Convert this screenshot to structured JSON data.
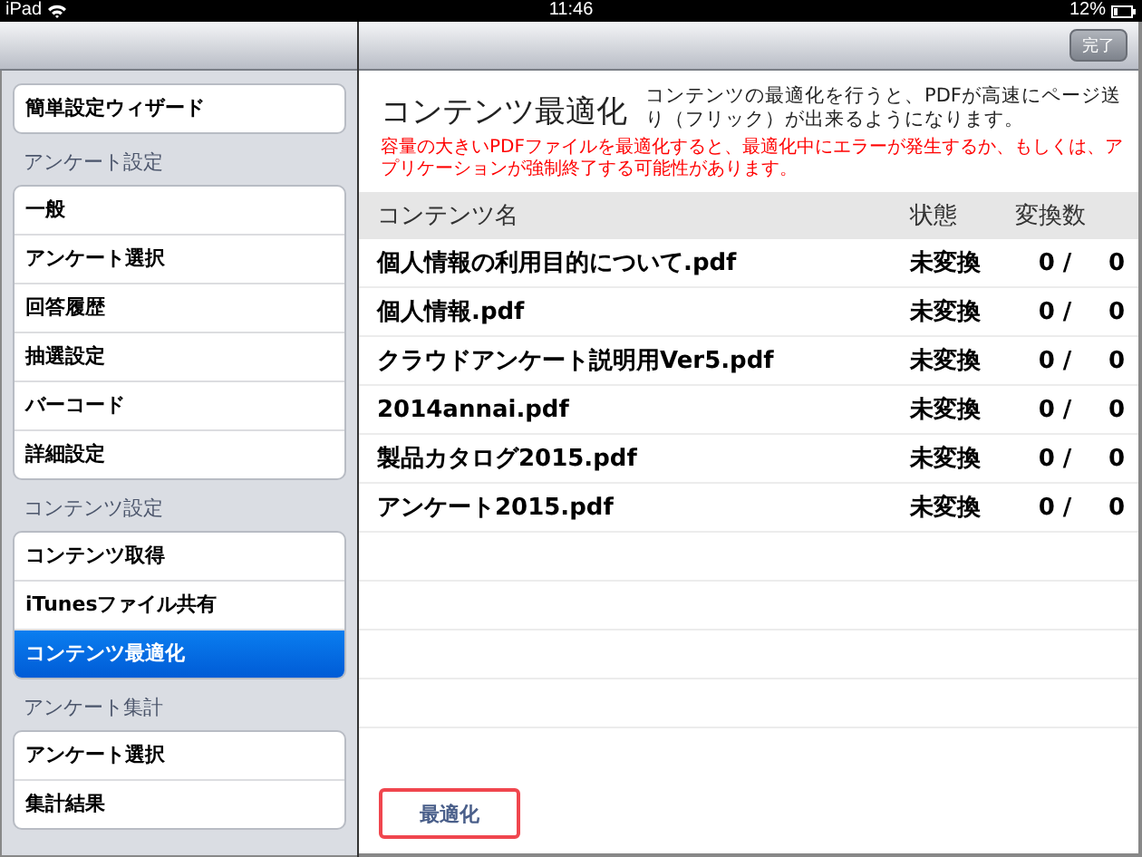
{
  "status_bar": {
    "device": "iPad",
    "time": "11:46",
    "battery": "12%"
  },
  "nav": {
    "done_button": "完了"
  },
  "sidebar": {
    "groups": [
      {
        "items": [
          {
            "label": "簡単設定ウィザード",
            "selected": false
          }
        ]
      },
      {
        "header": "アンケート設定",
        "items": [
          {
            "label": "一般",
            "selected": false
          },
          {
            "label": "アンケート選択",
            "selected": false
          },
          {
            "label": "回答履歴",
            "selected": false
          },
          {
            "label": "抽選設定",
            "selected": false
          },
          {
            "label": "バーコード",
            "selected": false
          },
          {
            "label": "詳細設定",
            "selected": false
          }
        ]
      },
      {
        "header": "コンテンツ設定",
        "items": [
          {
            "label": "コンテンツ取得",
            "selected": false
          },
          {
            "label": "iTunesファイル共有",
            "selected": false
          },
          {
            "label": "コンテンツ最適化",
            "selected": true
          }
        ]
      },
      {
        "header": "アンケート集計",
        "items": [
          {
            "label": "アンケート選択",
            "selected": false
          },
          {
            "label": "集計結果",
            "selected": false
          }
        ]
      }
    ]
  },
  "main": {
    "title": "コンテンツ最適化",
    "description": "コンテンツの最適化を行うと、PDFが高速にページ送り（フリック）が出来るようになります。",
    "warning": "容量の大きいPDFファイルを最適化すると、最適化中にエラーが発生するか、もしくは、アプリケーションが強制終了する可能性があります。",
    "table": {
      "columns": [
        "コンテンツ名",
        "状態",
        "変換数"
      ],
      "rows": [
        {
          "name": "個人情報の利用目的について.pdf",
          "status": "未変換",
          "done": "0 /",
          "total": "0"
        },
        {
          "name": "個人情報.pdf",
          "status": "未変換",
          "done": "0 /",
          "total": "0"
        },
        {
          "name": "クラウドアンケート説明用Ver5.pdf",
          "status": "未変換",
          "done": "0 /",
          "total": "0"
        },
        {
          "name": "2014annai.pdf",
          "status": "未変換",
          "done": "0 /",
          "total": "0"
        },
        {
          "name": "製品カタログ2015.pdf",
          "status": "未変換",
          "done": "0 /",
          "total": "0"
        },
        {
          "name": "アンケート2015.pdf",
          "status": "未変換",
          "done": "0 /",
          "total": "0"
        }
      ]
    },
    "optimize_button": "最適化"
  }
}
